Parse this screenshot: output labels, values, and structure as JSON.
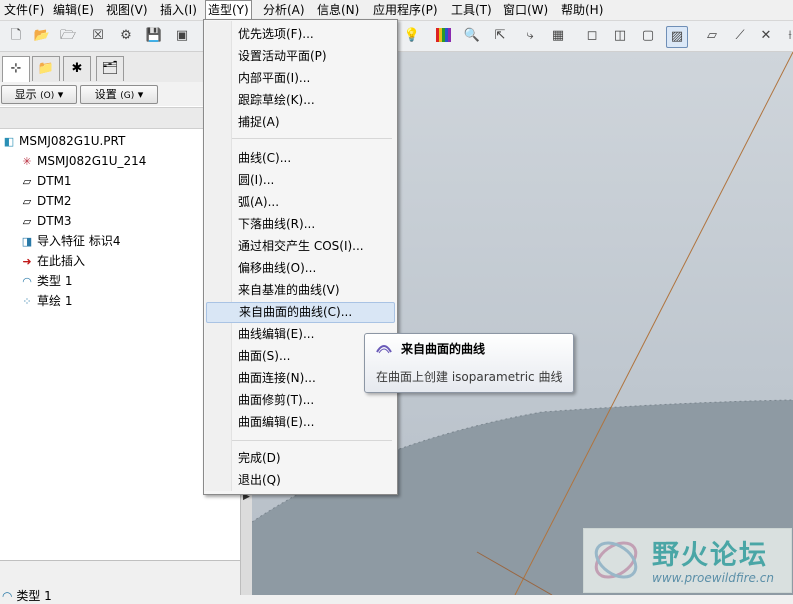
{
  "menubar": {
    "items": [
      "文件(F)",
      "编辑(E)",
      "视图(V)",
      "插入(I)",
      "造型(Y)",
      "分析(A)",
      "信息(N)",
      "应用程序(P)",
      "工具(T)",
      "窗口(W)",
      "帮助(H)"
    ],
    "active_index": 4
  },
  "left_panel": {
    "show_btn": "显示",
    "show_key": "(O)",
    "settings_btn": "设置",
    "settings_key": "(G)",
    "tree": [
      {
        "label": "MSMJ082G1U.PRT",
        "icon": "part-icon"
      },
      {
        "label": "MSMJ082G1U_214",
        "icon": "csys-icon"
      },
      {
        "label": "DTM1",
        "icon": "datum-plane-icon"
      },
      {
        "label": "DTM2",
        "icon": "datum-plane-icon"
      },
      {
        "label": "DTM3",
        "icon": "datum-plane-icon"
      },
      {
        "label": "导入特征 标识4",
        "icon": "import-feature-icon"
      },
      {
        "label": "在此插入",
        "icon": "insert-arrow-icon"
      },
      {
        "label": "类型 1",
        "icon": "surface-type-icon"
      },
      {
        "label": "草绘 1",
        "icon": "sketch-icon"
      }
    ],
    "bottom_item": "类型 1"
  },
  "dropdown": {
    "groups": [
      [
        "优先选项(F)...",
        "设置活动平面(P)",
        "内部平面(I)...",
        "跟踪草绘(K)...",
        "捕捉(A)"
      ],
      [
        "曲线(C)...",
        "圆(I)...",
        "弧(A)...",
        "下落曲线(R)...",
        "通过相交产生 COS(I)...",
        "偏移曲线(O)...",
        "来自基准的曲线(V)",
        "来自曲面的曲线(C)...",
        "曲线编辑(E)...",
        "曲面(S)...",
        "曲面连接(N)...",
        "曲面修剪(T)...",
        "曲面编辑(E)..."
      ],
      [
        "完成(D)",
        "退出(Q)"
      ]
    ],
    "highlighted": "来自曲面的曲线(C)..."
  },
  "tooltip": {
    "title": "来自曲面的曲线",
    "description": "在曲面上创建 isoparametric 曲线"
  },
  "watermark": {
    "title": "野火论坛",
    "url": "www.proewildfire.cn"
  },
  "colors": {
    "viewport_bg": "#c3cad2",
    "model_surface": "#8f9ba4",
    "menu_highlight": "#d9e6f5",
    "curve_line": "#b0743e"
  }
}
